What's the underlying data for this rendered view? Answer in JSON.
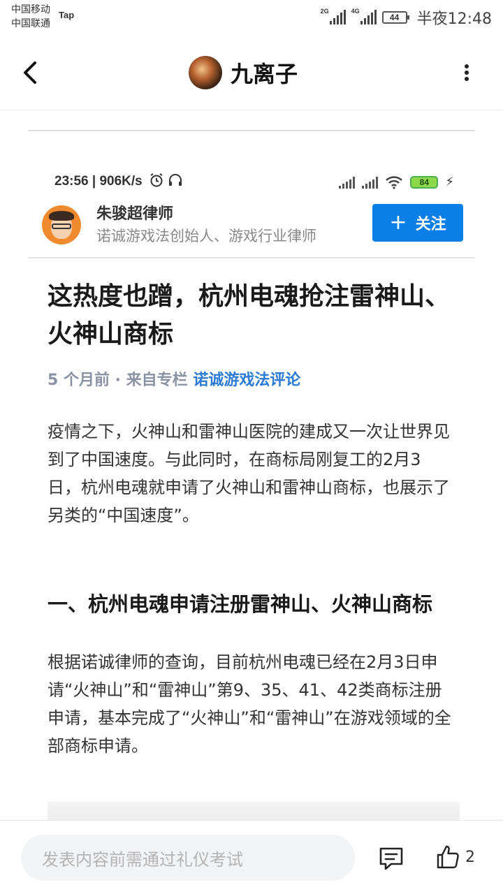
{
  "status_bar": {
    "carrier1": "中国移动",
    "carrier2": "中国联通",
    "carrier_tag": "Tap",
    "net1": "2G",
    "net2": "4G",
    "battery": "44",
    "time": "半夜12:48"
  },
  "nav": {
    "title": "九离子"
  },
  "embedded_status": {
    "time_speed": "23:56 | 906K/s",
    "battery": "84"
  },
  "author": {
    "name": "朱骏超律师",
    "description": "诺诚游戏法创始人、游戏行业律师",
    "follow_label": "关注"
  },
  "article": {
    "title": "这热度也蹭，杭州电魂抢注雷神山、火神山商标",
    "meta_prefix": "5 个月前 · 来自专栏 ",
    "column": "诺诚游戏法评论",
    "paragraph1": "疫情之下，火神山和雷神山医院的建成又一次让世界见到了中国速度。与此同时，在商标局刚复工的2月3日，杭州电魂就申请了火神山和雷神山商标，也展示了另类的“中国速度”。",
    "section1_title": "一、杭州电魂申请注册雷神山、火神山商标",
    "paragraph2": "根据诺诚律师的查询，目前杭州电魂已经在2月3日申请“火神山”和“雷神山”第9、35、41、42类商标注册申请，基本完成了“火神山”和“雷神山”在游戏领域的全部商标申请。"
  },
  "bottom_bar": {
    "comment_placeholder": "发表内容前需通过礼仪考试",
    "like_count": "2"
  },
  "colors": {
    "follow_button": "#0a7fe8",
    "column_link": "#2a7ad6",
    "meta_text": "#8a93a3"
  },
  "icons": [
    "back-icon",
    "more-icon",
    "alarm-icon",
    "headset-icon",
    "wifi-icon",
    "plus-icon",
    "comment-icon",
    "thumbs-up-icon"
  ]
}
